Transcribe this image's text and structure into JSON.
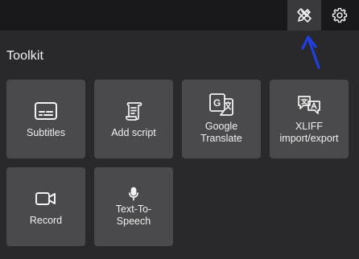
{
  "topbar": {
    "tools_icon": "pencil-ruler-icon",
    "settings_icon": "gear-icon"
  },
  "toolkit": {
    "heading": "Toolkit",
    "tiles": [
      {
        "label": "Subtitles",
        "icon": "subtitles-icon"
      },
      {
        "label": "Add script",
        "icon": "script-scroll-icon"
      },
      {
        "label": "Google\nTranslate",
        "icon": "google-translate-icon"
      },
      {
        "label": "XLIFF\nimport/export",
        "icon": "translate-bubbles-icon"
      },
      {
        "label": "Record",
        "icon": "video-camera-icon"
      },
      {
        "label": "Text-To-\nSpeech",
        "icon": "microphone-icon"
      }
    ]
  },
  "colors": {
    "topbar_bg": "#19191b",
    "panel_bg": "#29292c",
    "tile_bg": "#4a4a4d",
    "annotation_arrow": "#1f3fe0"
  }
}
